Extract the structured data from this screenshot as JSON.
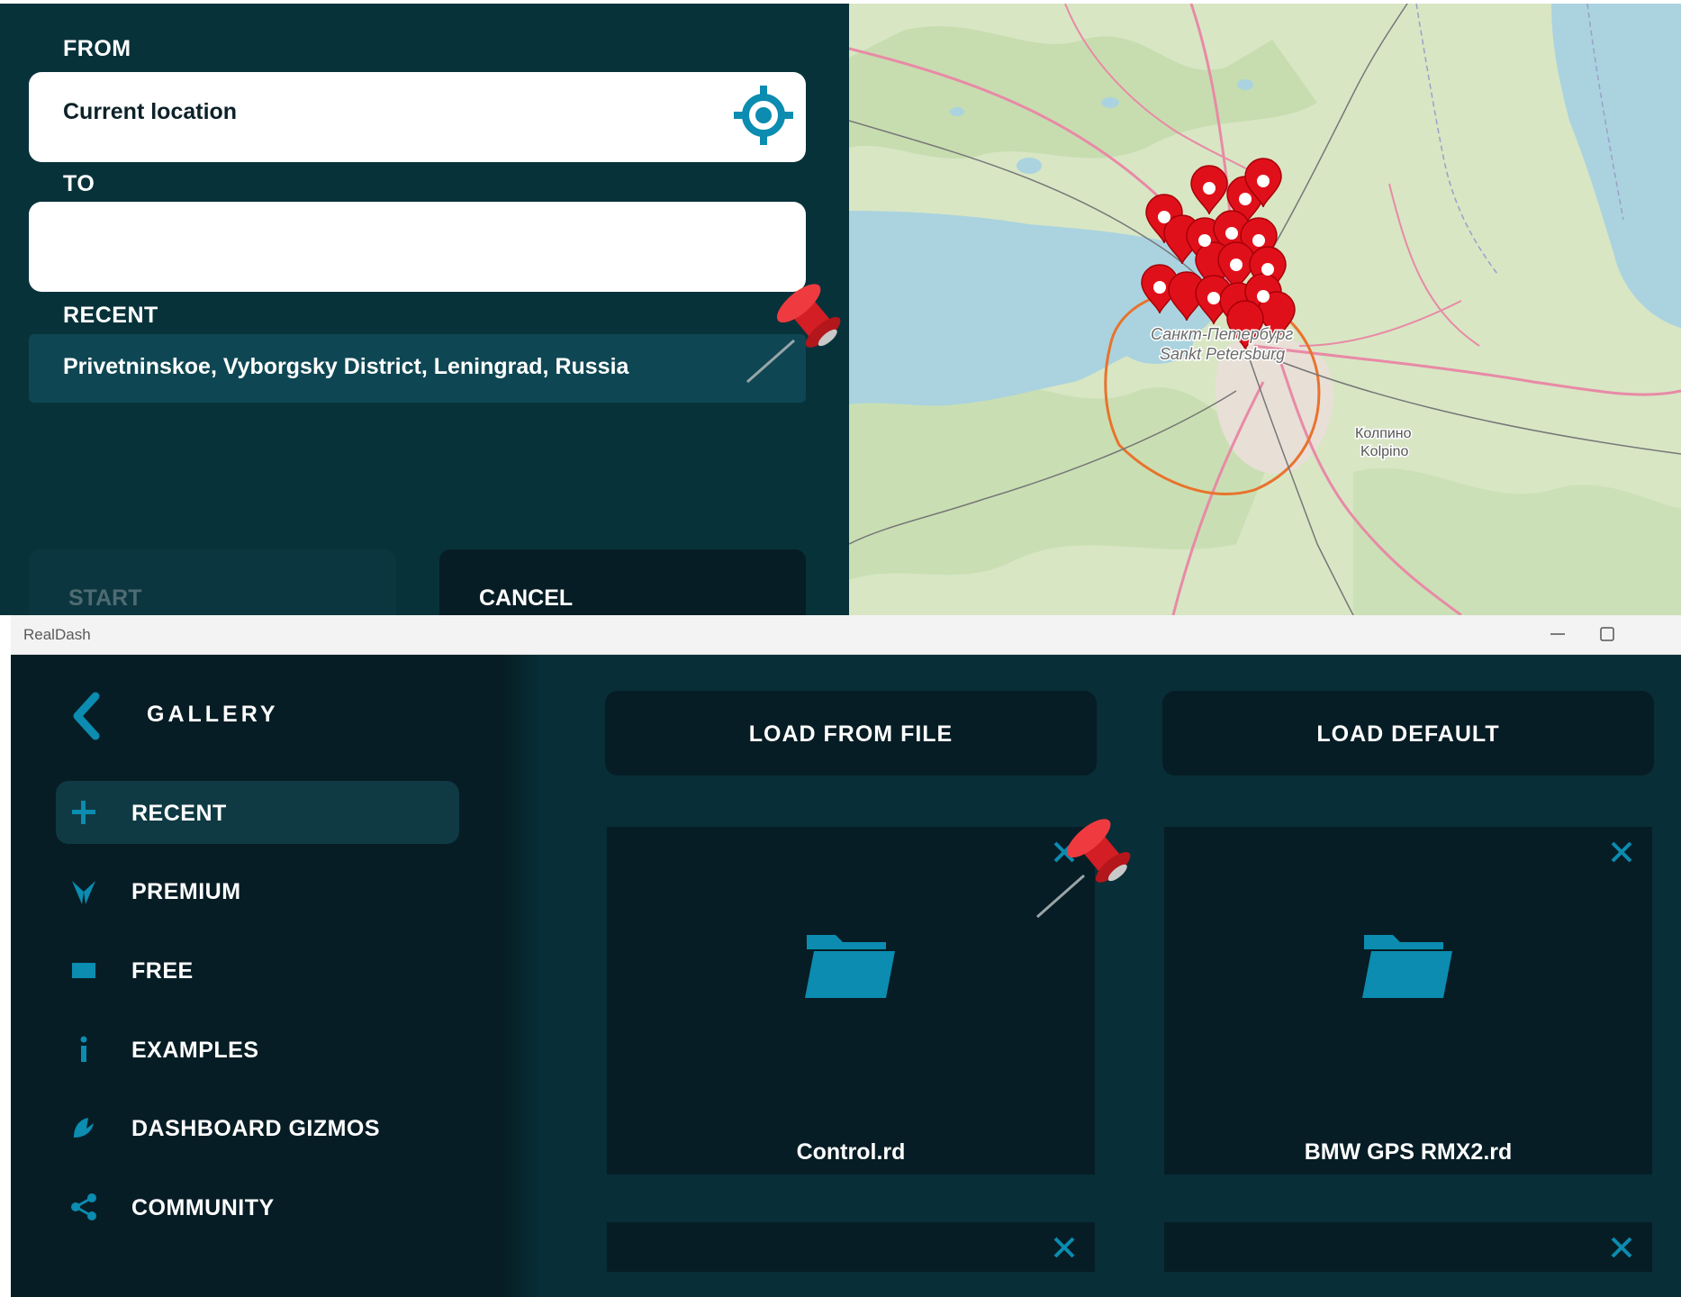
{
  "navigation": {
    "from_label": "FROM",
    "from_value": "Current location",
    "to_label": "TO",
    "to_value": "",
    "recent_label": "RECENT",
    "recent_items": [
      "Privetninskoe, Vyborgsky District, Leningrad, Russia"
    ],
    "start_label": "START",
    "cancel_label": "CANCEL",
    "locate_icon": "crosshair-target-icon"
  },
  "map": {
    "city_label_ru": "Санкт-Петербург",
    "city_label_en": "Sankt Petersburg",
    "town_label_ru": "Колпино",
    "town_label_en": "Kolpino",
    "marker_color": "#e0101a",
    "marker_icon": "camera-marker-icon"
  },
  "window": {
    "title": "RealDash",
    "minimize_glyph": "—",
    "maximize_glyph": "☐"
  },
  "gallery": {
    "title": "GALLERY",
    "back_icon": "chevron-left-icon",
    "menu": [
      {
        "label": "RECENT",
        "icon": "plus-icon",
        "active": true
      },
      {
        "label": "PREMIUM",
        "icon": "premium-logo-icon",
        "active": false
      },
      {
        "label": "FREE",
        "icon": "monitor-icon",
        "active": false
      },
      {
        "label": "EXAMPLES",
        "icon": "info-icon",
        "active": false
      },
      {
        "label": "DASHBOARD GIZMOS",
        "icon": "gauge-icon",
        "active": false
      },
      {
        "label": "COMMUNITY",
        "icon": "share-icon",
        "active": false
      }
    ],
    "load_from_file_label": "LOAD FROM FILE",
    "load_default_label": "LOAD DEFAULT",
    "files": [
      {
        "name": "Control.rd",
        "icon": "folder-icon"
      },
      {
        "name": "BMW GPS RMX2.rd",
        "icon": "folder-icon"
      },
      {
        "name": "",
        "icon": ""
      },
      {
        "name": "",
        "icon": ""
      }
    ],
    "close_glyph": "✕"
  },
  "colors": {
    "accent": "#0b8cb0",
    "nav_bg": "#08323a",
    "sidebar_bg": "#071d25",
    "content_bg": "#082e37",
    "pin_red": "#e0262a"
  }
}
